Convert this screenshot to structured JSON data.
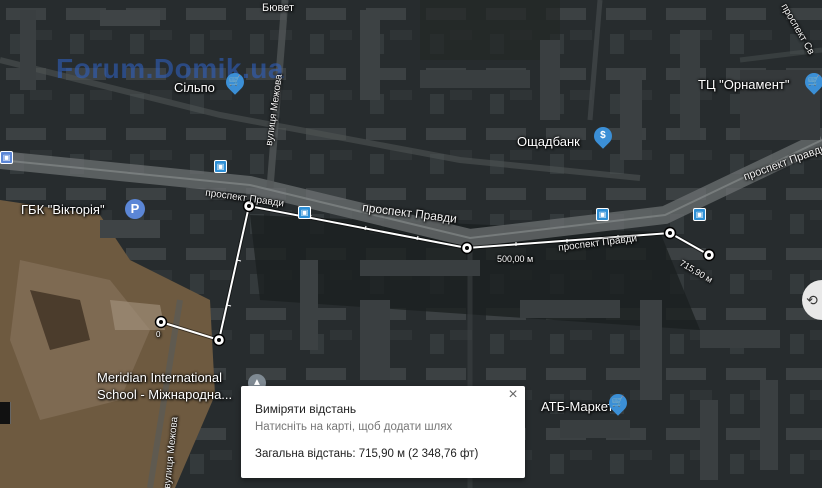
{
  "map": {
    "watermark": "Forum.Domik.ua",
    "streets": {
      "top_fragment": "Бювет",
      "vulytsia_mezhova": "вулиця Межова",
      "prospekt_pravdy_left": "проспект Правди",
      "prospekt_pravdy_center": "проспект Правди",
      "prospekt_pravdy_right": "проспект Правди",
      "prospekt_pravdy_upper_right": "проспект Правди",
      "prospekt_sv_fragment": "проспект Св",
      "vulytsia_mezhova_bottom": "вулиця Межова"
    },
    "places": {
      "silpo": "Сільпо",
      "oshchadbank": "Ощадбанк",
      "tc_ornament": "ТЦ \"Орнамент\"",
      "gbk_viktoriia": "ГБК \"Вікторія\"",
      "meridian_line1": "Meridian International",
      "meridian_line2": "School - Міжнародна...",
      "atb": "АТБ-Маркет"
    },
    "measure_labels": {
      "start": "0",
      "mid": "500,00 м",
      "end": "715,90 м"
    },
    "icons": {
      "shopping_pin": "shopping-cart-icon",
      "bank_pin": "bank-icon",
      "school_pin": "school-icon",
      "parking": "parking-icon",
      "transit": "bus-stop-icon"
    },
    "colors": {
      "pin_blue": "#3b8fd6",
      "route_line": "#ffffff",
      "parking_blue": "#5b86d6"
    }
  },
  "panel": {
    "title": "Виміряти відстань",
    "hint": "Натисніть на карті, щоб додати шлях",
    "total": "Загальна відстань: 715,90 м (2 348,76 фт)",
    "close_icon": "close-icon"
  }
}
